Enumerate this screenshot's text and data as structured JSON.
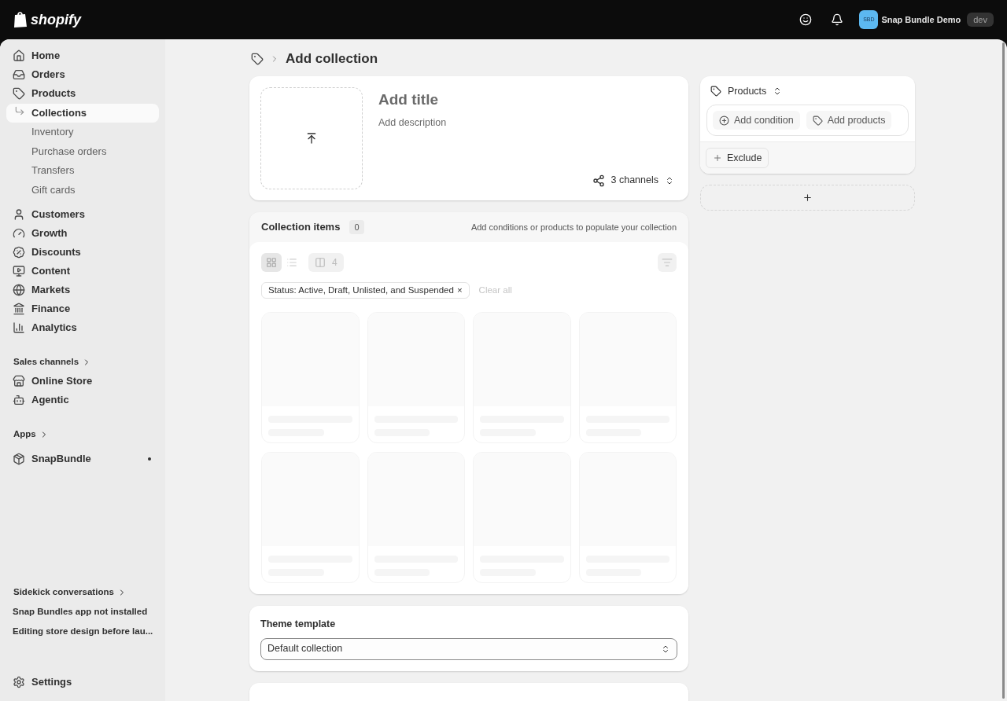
{
  "topbar": {
    "brand": "shopify",
    "store_initials": "SBD",
    "store_name": "Snap Bundle Demo",
    "badge": "dev"
  },
  "sidebar": {
    "items": [
      {
        "label": "Home",
        "selected": false
      },
      {
        "label": "Orders",
        "selected": false
      },
      {
        "label": "Products",
        "selected": false,
        "children": [
          {
            "label": "Collections",
            "selected": true
          },
          {
            "label": "Inventory",
            "selected": false
          },
          {
            "label": "Purchase orders",
            "selected": false
          },
          {
            "label": "Transfers",
            "selected": false
          },
          {
            "label": "Gift cards",
            "selected": false
          }
        ]
      },
      {
        "label": "Customers",
        "selected": false
      },
      {
        "label": "Growth",
        "selected": false
      },
      {
        "label": "Discounts",
        "selected": false
      },
      {
        "label": "Content",
        "selected": false
      },
      {
        "label": "Markets",
        "selected": false
      },
      {
        "label": "Finance",
        "selected": false
      },
      {
        "label": "Analytics",
        "selected": false
      }
    ],
    "sales_channels": {
      "heading": "Sales channels",
      "items": [
        {
          "label": "Online Store",
          "selected": false
        },
        {
          "label": "Agentic",
          "selected": false
        }
      ]
    },
    "apps": {
      "heading": "Apps",
      "items": [
        {
          "label": "SnapBundle",
          "selected": false
        }
      ]
    },
    "sidekick": {
      "heading": "Sidekick conversations",
      "items": [
        "Snap Bundles app not installed",
        "Editing store design before lau..."
      ]
    },
    "settings": "Settings"
  },
  "page": {
    "title": "Add collection"
  },
  "details": {
    "title_placeholder": "Add title",
    "description_placeholder": "Add description",
    "channels": "3 channels"
  },
  "collection_items": {
    "heading": "Collection items",
    "count": "0",
    "hint": "Add conditions or products to populate your collection",
    "views": [
      {
        "kind": "grid",
        "selected": true
      },
      {
        "kind": "list",
        "selected": false
      }
    ],
    "columns": "4",
    "filter_chip": "Status: Active, Draft, Unlisted, and Suspended",
    "chip_remove": "×",
    "clear_all": "Clear all"
  },
  "theme_template": {
    "label": "Theme template",
    "value": "Default collection"
  },
  "rules": {
    "source": "Products",
    "buttons": [
      "Add condition",
      "Add products"
    ],
    "exclude": "Exclude"
  }
}
